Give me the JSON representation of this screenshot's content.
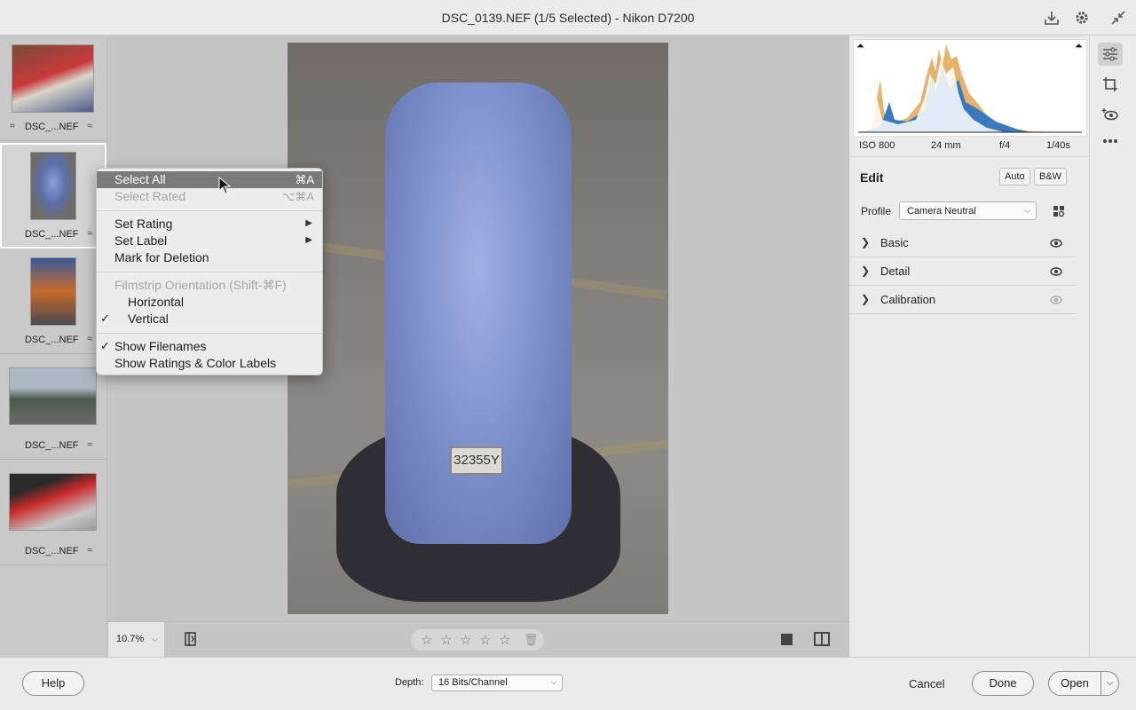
{
  "window": {
    "title": "DSC_0139.NEF (1/5 Selected)  -  Nikon D7200"
  },
  "filmstrip": {
    "items": [
      {
        "filename": "DSC_...NEF",
        "selected": false,
        "has_crop": true
      },
      {
        "filename": "DSC_...NEF",
        "selected": true,
        "has_crop": false
      },
      {
        "filename": "DSC_...NEF",
        "selected": false,
        "has_crop": false
      },
      {
        "filename": "DSC_...NEF",
        "selected": false,
        "has_crop": false
      },
      {
        "filename": "DSC_...NEF",
        "selected": false,
        "has_crop": false
      }
    ]
  },
  "photo": {
    "plate_text": "32355Y"
  },
  "context_menu": {
    "select_all": {
      "label": "Select All",
      "shortcut": "⌘A"
    },
    "select_rated": {
      "label": "Select Rated",
      "shortcut": "⌥⌘A"
    },
    "set_rating": "Set Rating",
    "set_label": "Set Label",
    "mark_deletion": "Mark for Deletion",
    "orientation_header": "Filmstrip Orientation (Shift-⌘F)",
    "horizontal": "Horizontal",
    "vertical": "Vertical",
    "show_filenames": "Show Filenames",
    "show_ratings": "Show Ratings & Color Labels"
  },
  "canvas_bar": {
    "zoom": "10.7%",
    "rating_stars": 0
  },
  "panel": {
    "meta": {
      "iso": "ISO 800",
      "focal": "24 mm",
      "aperture": "f/4",
      "shutter": "1/40s"
    },
    "edit_title": "Edit",
    "auto_label": "Auto",
    "bw_label": "B&W",
    "profile_label": "Profile",
    "profile_value": "Camera Neutral",
    "sections": [
      {
        "label": "Basic",
        "visible": true
      },
      {
        "label": "Detail",
        "visible": true
      },
      {
        "label": "Calibration",
        "visible": false
      }
    ]
  },
  "footer": {
    "help": "Help",
    "depth_label": "Depth:",
    "depth_value": "16 Bits/Channel",
    "cancel": "Cancel",
    "done": "Done",
    "open": "Open"
  },
  "colors": {
    "menu_highlight": "#7a7a7a",
    "bike_blue": "#7d8fcb"
  }
}
